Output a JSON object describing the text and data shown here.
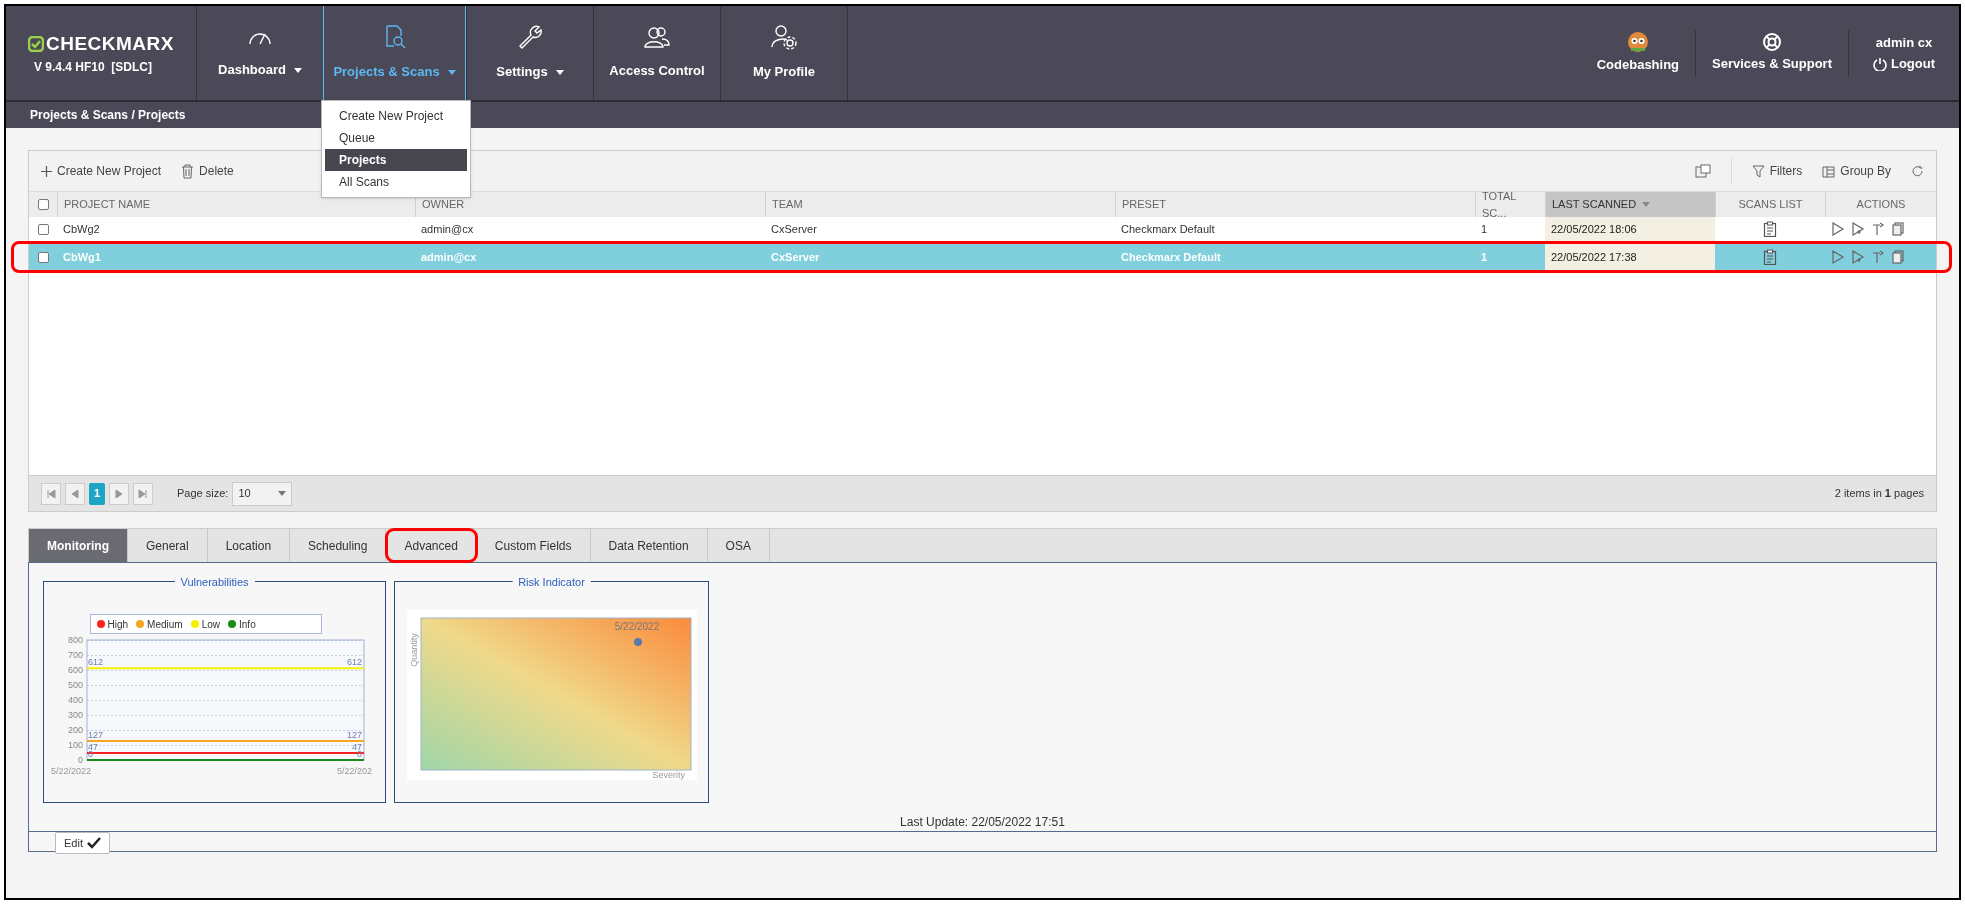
{
  "header": {
    "logo": "CHECKMARX",
    "version": "V 9.4.4 HF10  [SDLC]",
    "nav": [
      {
        "label": "Dashboard",
        "dropdown": true,
        "selected": false
      },
      {
        "label": "Projects & Scans",
        "dropdown": true,
        "selected": true
      },
      {
        "label": "Settings",
        "dropdown": true,
        "selected": false
      },
      {
        "label": "Access Control",
        "dropdown": false,
        "selected": false
      },
      {
        "label": "My Profile",
        "dropdown": false,
        "selected": false
      }
    ],
    "right": [
      {
        "label": "Codebashing"
      },
      {
        "label": "Services & Support"
      }
    ],
    "user": "admin cx",
    "logout": "Logout"
  },
  "menu": [
    {
      "label": "Create New Project",
      "selected": false
    },
    {
      "label": "Queue",
      "selected": false
    },
    {
      "label": "Projects",
      "selected": true
    },
    {
      "label": "All Scans",
      "selected": false
    }
  ],
  "breadcrumb": "Projects & Scans / Projects",
  "toolbar": {
    "create": "Create New Project",
    "delete": "Delete",
    "filters": "Filters",
    "group_by": "Group By"
  },
  "table": {
    "all_checked": false,
    "columns": [
      {
        "label": "PROJECT NAME",
        "sorted": false
      },
      {
        "label": "OWNER",
        "sorted": false
      },
      {
        "label": "TEAM",
        "sorted": false
      },
      {
        "label": "PRESET",
        "sorted": false
      },
      {
        "label": "TOTAL SC...",
        "sorted": false
      },
      {
        "label": "LAST SCANNED",
        "sorted": true
      },
      {
        "label": "SCANS LIST",
        "sorted": false
      },
      {
        "label": "ACTIONS",
        "sorted": false
      }
    ],
    "rows": [
      {
        "name": "CbWg2",
        "owner": "admin@cx",
        "team": "CxServer",
        "preset": "Checkmarx Default",
        "total": "1",
        "last_scanned": "22/05/2022 18:06",
        "checked": false,
        "selected": false,
        "annotated": false
      },
      {
        "name": "CbWg1",
        "owner": "admin@cx",
        "team": "CxServer",
        "preset": "Checkmarx Default",
        "total": "1",
        "last_scanned": "22/05/2022 17:38",
        "checked": false,
        "selected": true,
        "annotated": true
      }
    ]
  },
  "pager": {
    "pages": [
      {
        "label": "1",
        "selected": true
      }
    ],
    "page_size_label": "Page size:",
    "page_size": "10",
    "summary": "2 items in **1** pages"
  },
  "tabs": [
    {
      "label": "Monitoring",
      "selected": true,
      "annotated": false
    },
    {
      "label": "General",
      "selected": false,
      "annotated": false
    },
    {
      "label": "Location",
      "selected": false,
      "annotated": false
    },
    {
      "label": "Scheduling",
      "selected": false,
      "annotated": false
    },
    {
      "label": "Advanced",
      "selected": false,
      "annotated": true
    },
    {
      "label": "Custom Fields",
      "selected": false,
      "annotated": false
    },
    {
      "label": "Data Retention",
      "selected": false,
      "annotated": false
    },
    {
      "label": "OSA",
      "selected": false,
      "annotated": false
    }
  ],
  "monitoring": {
    "vulnerabilities": {
      "title": "Vulnerabilities",
      "chart_data": {
        "type": "line",
        "legend": "top",
        "categories": [
          "5/22/2022",
          "5/22/202"
        ],
        "ylim": [
          0,
          800
        ],
        "yticks": [
          0,
          100,
          200,
          300,
          400,
          500,
          600,
          700,
          800
        ],
        "data_labels": true,
        "series": [
          {
            "name": "High",
            "color": "#ff2020",
            "values": [
              47,
              47
            ]
          },
          {
            "name": "Medium",
            "color": "#f5a623",
            "values": [
              127,
              127
            ]
          },
          {
            "name": "Low",
            "color": "#f2f200",
            "values": [
              612,
              612
            ]
          },
          {
            "name": "Info",
            "color": "#1a8a1a",
            "values": [
              0,
              0
            ]
          }
        ]
      }
    },
    "risk": {
      "title": "Risk Indicator",
      "point_label": "5/22/2022",
      "ylabel": "Quantity",
      "xlabel": "Severity"
    },
    "last_update": "Last Update: 22/05/2022 17:51",
    "edit": "Edit"
  }
}
